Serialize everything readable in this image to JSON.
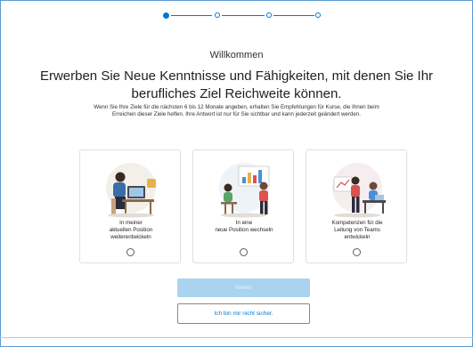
{
  "stepper": {
    "total_steps": 4,
    "current_step": 1
  },
  "page": {
    "welcome": "Willkommen",
    "headline": "Erwerben Sie Neue Kenntnisse und Fähigkeiten, mit denen Sie Ihr berufliches Ziel Reichweite können.",
    "intro": "Wenn Sie Ihre Ziele für die nächsten 6 bis 12 Monate angeben, erhalten Sie Empfehlungen für Kurse, die Ihnen beim Erreichen dieser Ziele helfen. Ihre Antwort ist nur für Sie sichtbar und kann jederzeit geändert werden."
  },
  "options": [
    {
      "label": "In meiner\naktuellen Position\nweiterentwickeln",
      "selected": false,
      "illustration": "person-at-desk-illustration"
    },
    {
      "label": "In eine\nneue Position wechseln",
      "selected": false,
      "illustration": "presentation-illustration"
    },
    {
      "label": "Kompetenzen für die\nLeitung von Teams\nentwickeln",
      "selected": false,
      "illustration": "team-meeting-illustration"
    }
  ],
  "buttons": {
    "next": "Weiter",
    "not_sure": "Ich bin mir nicht sicher."
  },
  "colors": {
    "accent": "#0078d4",
    "disabled_button": "#a9d3ef",
    "frame_border": "#5b9bd5"
  }
}
